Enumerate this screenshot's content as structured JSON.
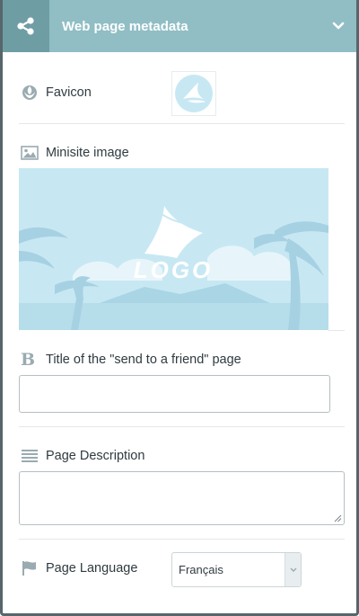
{
  "header": {
    "title": "Web page metadata",
    "share_icon": "share-icon",
    "collapse_icon": "chevron-down-icon"
  },
  "favicon": {
    "label": "Favicon",
    "icon": "rebel-icon"
  },
  "minisite": {
    "label": "Minisite image",
    "icon": "image-icon",
    "logo_text": "LOGO"
  },
  "send_title": {
    "label": "Title of the \"send to a friend\" page",
    "icon": "bold-icon",
    "value": ""
  },
  "description": {
    "label": "Page Description",
    "icon": "lines-icon",
    "value": ""
  },
  "language": {
    "label": "Page Language",
    "icon": "flag-icon",
    "selected": "Français"
  },
  "colors": {
    "header": "#90bec4",
    "header_dark": "#6f9da4",
    "icon": "#9aabb1",
    "image_bg": "#c7e8f3"
  }
}
